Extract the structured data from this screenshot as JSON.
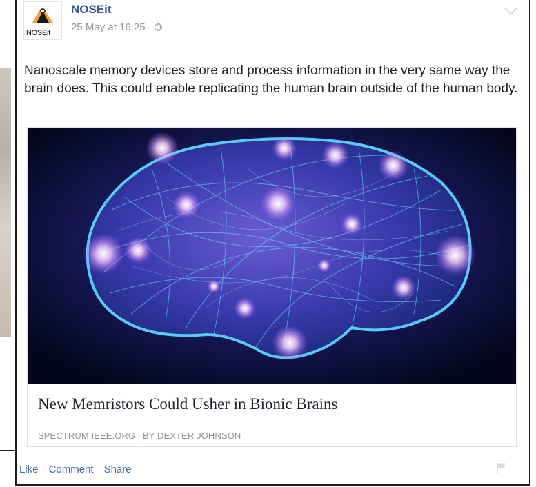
{
  "post": {
    "page_name": "NOSEit",
    "avatar_text": "NOSEit",
    "timestamp": "25 May at 16:25",
    "timestamp_sep": "·",
    "text": "Nanoscale memory devices store and process information in the very same way the brain does. This could enable replicating the human brain outside of the human body.",
    "link": {
      "title": "New Memristors Could Usher in Bionic Brains",
      "meta": "SPECTRUM.IEEE.ORG | BY DEXTER JOHNSON",
      "image_alt": "glowing neural network brain"
    },
    "actions": {
      "like": "Like",
      "comment": "Comment",
      "share": "Share",
      "separator": "·"
    }
  },
  "colors": {
    "link_blue": "#365899",
    "action_blue": "#4267b2",
    "meta_gray": "#90949c",
    "text": "#1d2129"
  },
  "icons": [
    "chevron-down-icon",
    "globe-icon",
    "flag-icon"
  ]
}
